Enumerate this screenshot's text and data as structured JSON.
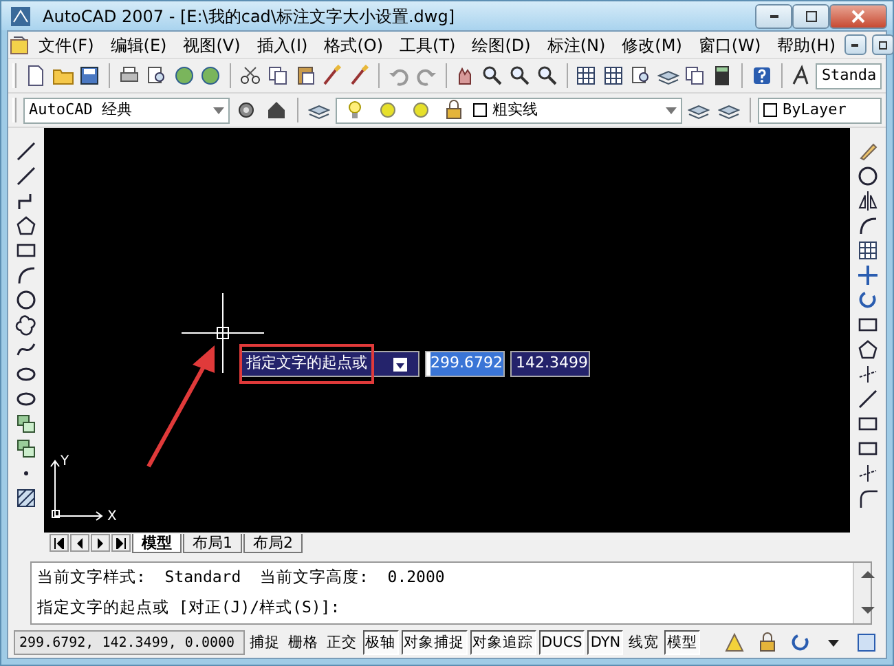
{
  "window": {
    "title": "AutoCAD 2007 - [E:\\我的cad\\标注文字大小设置.dwg]"
  },
  "menu": [
    {
      "label": "文件(F)"
    },
    {
      "label": "编辑(E)"
    },
    {
      "label": "视图(V)"
    },
    {
      "label": "插入(I)"
    },
    {
      "label": "格式(O)"
    },
    {
      "label": "工具(T)"
    },
    {
      "label": "绘图(D)"
    },
    {
      "label": "标注(N)"
    },
    {
      "label": "修改(M)"
    },
    {
      "label": "窗口(W)"
    },
    {
      "label": "帮助(H)"
    }
  ],
  "toolbar": {
    "text_style": "Standa"
  },
  "workspace_bar": {
    "workspace": "AutoCAD 经典",
    "layer": "粗实线",
    "color_control": "ByLayer"
  },
  "canvas": {
    "ucs_labels": [
      "Y",
      "X"
    ],
    "dynamic_input": {
      "prompt": "指定文字的起点或",
      "x_value": "299.6792",
      "y_value": "142.3499"
    }
  },
  "layout_tabs": [
    {
      "label": "模型",
      "selected": true
    },
    {
      "label": "布局1",
      "selected": false
    },
    {
      "label": "布局2",
      "selected": false
    }
  ],
  "command_lines": [
    "当前文字样式:  Standard  当前文字高度:  0.2000",
    "指定文字的起点或 [对正(J)/样式(S)]:"
  ],
  "status_bar": {
    "coordinates": "299.6792, 142.3499, 0.0000",
    "toggles": [
      {
        "label": "捕捉",
        "on": false
      },
      {
        "label": "栅格",
        "on": false
      },
      {
        "label": "正交",
        "on": false
      },
      {
        "label": "极轴",
        "on": true
      },
      {
        "label": "对象捕捉",
        "on": true
      },
      {
        "label": "对象追踪",
        "on": true
      },
      {
        "label": "DUCS",
        "on": true
      },
      {
        "label": "DYN",
        "on": true
      },
      {
        "label": "线宽",
        "on": false
      },
      {
        "label": "模型",
        "on": true
      }
    ]
  }
}
